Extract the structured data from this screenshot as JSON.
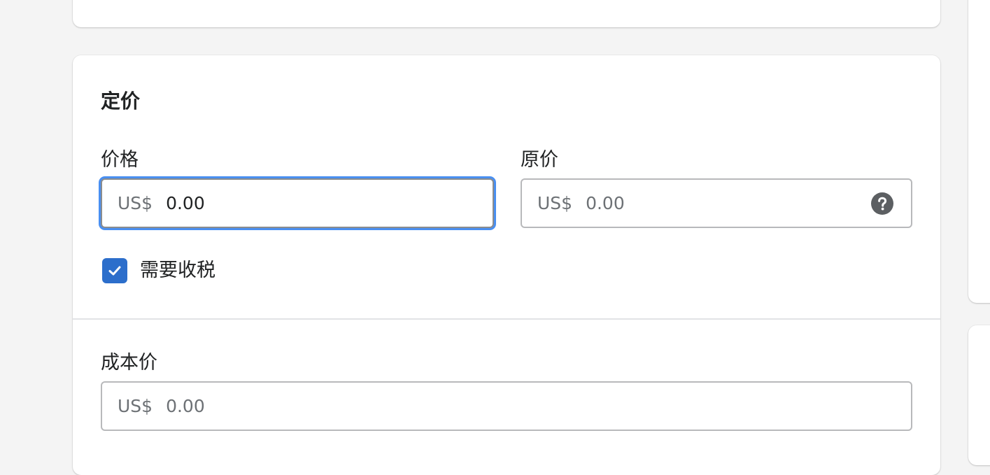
{
  "pricing": {
    "title": "定价",
    "price": {
      "label": "价格",
      "currency_prefix": "US$",
      "value": "0.00"
    },
    "compare_at_price": {
      "label": "原价",
      "currency_prefix": "US$",
      "placeholder": "0.00",
      "help_icon": "question-circle-icon"
    },
    "charge_tax": {
      "label": "需要收税",
      "checked": true,
      "icon": "checkmark-icon"
    },
    "cost_per_item": {
      "label": "成本价",
      "currency_prefix": "US$",
      "placeholder": "0.00"
    }
  },
  "colors": {
    "primary": "#2c6ecb",
    "focus_ring": "#4a8ff0",
    "text": "#202223",
    "subdued_text": "#6d7175",
    "background": "#f4f4f4"
  }
}
